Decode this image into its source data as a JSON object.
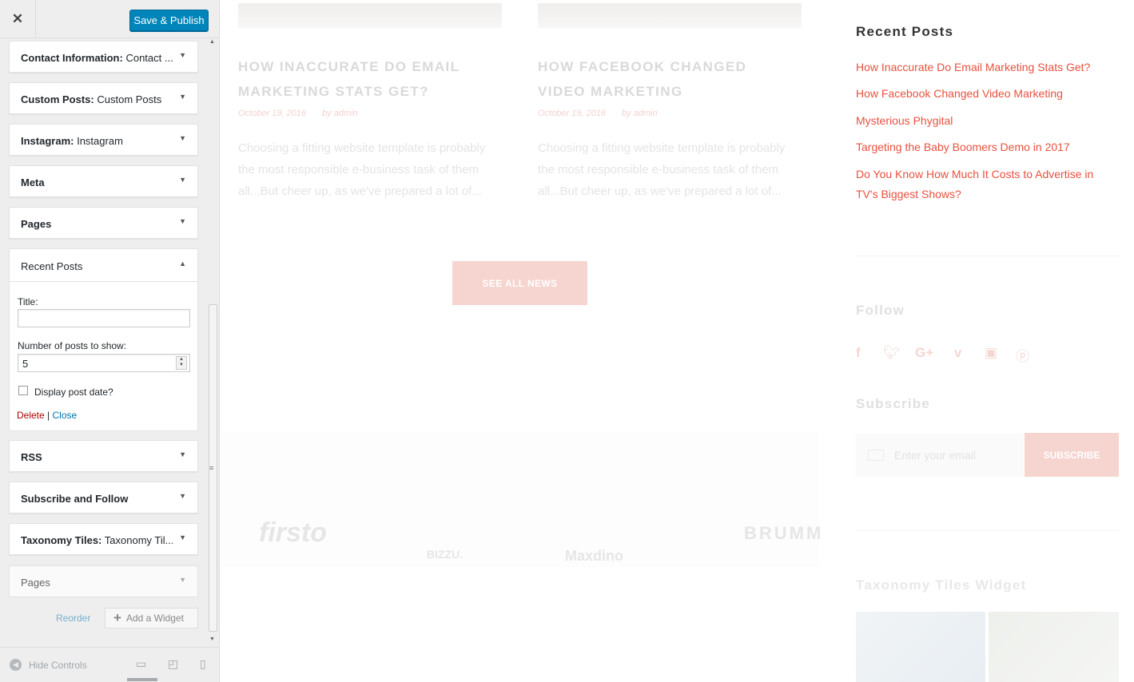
{
  "panel": {
    "close_icon": "close-icon",
    "publish_label": "Save & Publish",
    "widgets_top": [
      {
        "title": "Contact Information:",
        "subtitle": "Contact ..."
      },
      {
        "title": "Custom Posts:",
        "subtitle": "Custom Posts"
      },
      {
        "title": "Instagram:",
        "subtitle": "Instagram"
      },
      {
        "title": "Meta",
        "subtitle": ""
      },
      {
        "title": "Pages",
        "subtitle": ""
      }
    ],
    "recent_posts": {
      "title": "Recent Posts",
      "title_label": "Title:",
      "title_value": "",
      "count_label": "Number of posts to show:",
      "count_value": "5",
      "date_label": "Display post date?",
      "date_checked": false,
      "delete_label": "Delete",
      "separator": "|",
      "close_label": "Close"
    },
    "widgets_bottom": [
      {
        "title": "RSS",
        "subtitle": ""
      },
      {
        "title": "Subscribe and Follow",
        "subtitle": ""
      },
      {
        "title": "Taxonomy Tiles:",
        "subtitle": "Taxonomy Til..."
      }
    ],
    "dragging_widget": "Pages",
    "reorder_label": "Reorder",
    "add_widget_label": "Add a Widget",
    "hide_controls_label": "Hide Controls"
  },
  "preview": {
    "posts": [
      {
        "title": "HOW INACCURATE DO EMAIL MARKETING STATS GET?",
        "date": "October 19, 2016",
        "author": "by admin",
        "excerpt": "Choosing a fitting website template is probably the most responsible e-business task of them all...But cheer up, as we've prepared a lot of..."
      },
      {
        "title": "HOW FACEBOOK CHANGED VIDEO MARKETING",
        "date": "October 19, 2016",
        "author": "by admin",
        "excerpt": "Choosing a fitting website template is probably the most responsible e-business task of them all...But cheer up, as we've prepared a lot of..."
      }
    ],
    "see_all_label": "SEE ALL NEWS",
    "logos": [
      "firsto",
      "BIZZU.",
      "Maxdino",
      "BRUMM"
    ],
    "sidebar": {
      "recent_posts_title": "Recent Posts",
      "recent_posts": [
        "How Inaccurate Do Email Marketing Stats Get?",
        "How Facebook Changed Video Marketing",
        "Mysterious Phygital",
        "Targeting the Baby Boomers Demo in 2017",
        "Do You Know How Much It Costs to Advertise in TV's Biggest Shows?"
      ],
      "follow_title": "Follow",
      "subscribe_title": "Subscribe",
      "email_placeholder": "Enter your email",
      "subscribe_label": "SUBSCRIBE",
      "taxonomy_title": "Taxonomy Tiles Widget"
    }
  },
  "colors": {
    "accent": "#e8513f",
    "publish": "#0085ba"
  }
}
